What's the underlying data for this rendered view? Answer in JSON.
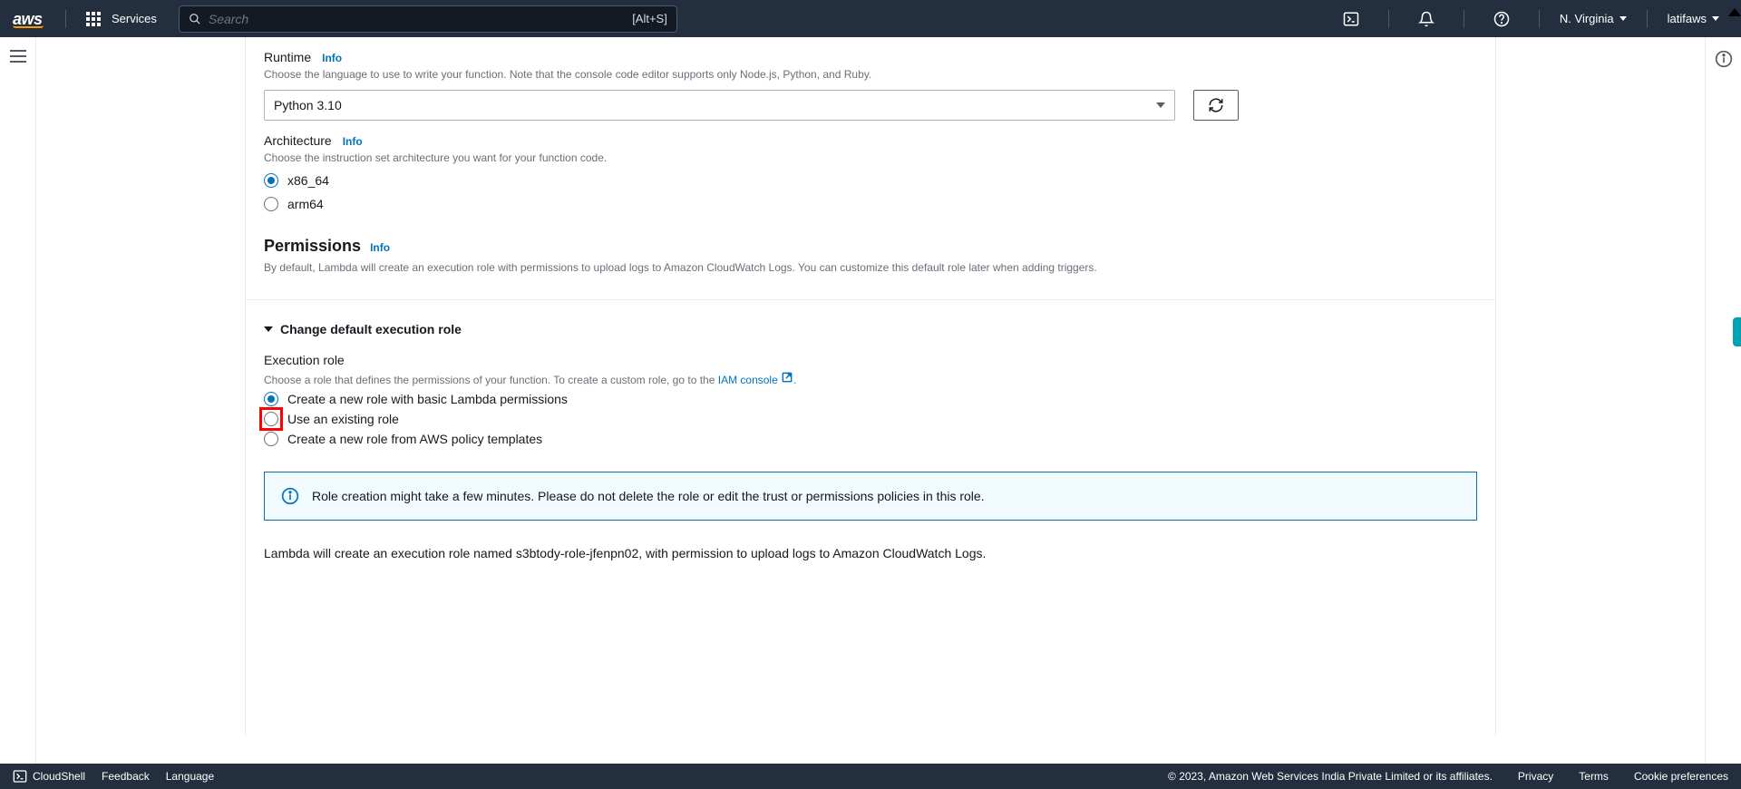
{
  "topnav": {
    "logo": "aws",
    "services": "Services",
    "search_placeholder": "Search",
    "search_kbd": "[Alt+S]",
    "region": "N. Virginia",
    "user": "latifaws"
  },
  "runtime": {
    "label": "Runtime",
    "info": "Info",
    "desc": "Choose the language to use to write your function. Note that the console code editor supports only Node.js, Python, and Ruby.",
    "selected": "Python 3.10"
  },
  "architecture": {
    "label": "Architecture",
    "info": "Info",
    "desc": "Choose the instruction set architecture you want for your function code.",
    "options": [
      "x86_64",
      "arm64"
    ],
    "selected": "x86_64"
  },
  "permissions": {
    "heading": "Permissions",
    "info": "Info",
    "desc": "By default, Lambda will create an execution role with permissions to upload logs to Amazon CloudWatch Logs. You can customize this default role later when adding triggers."
  },
  "exec_role": {
    "expander": "Change default execution role",
    "label": "Execution role",
    "desc_pre": "Choose a role that defines the permissions of your function. To create a custom role, go to the ",
    "iam_link": "IAM console",
    "desc_post": ".",
    "options": [
      "Create a new role with basic Lambda permissions",
      "Use an existing role",
      "Create a new role from AWS policy templates"
    ],
    "selected": "Create a new role with basic Lambda permissions"
  },
  "alert": "Role creation might take a few minutes. Please do not delete the role or edit the trust or permissions policies in this role.",
  "note": "Lambda will create an execution role named s3btody-role-jfenpn02, with permission to upload logs to Amazon CloudWatch Logs.",
  "footer": {
    "cloudshell": "CloudShell",
    "feedback": "Feedback",
    "language": "Language",
    "copyright": "© 2023, Amazon Web Services India Private Limited or its affiliates.",
    "privacy": "Privacy",
    "terms": "Terms",
    "cookies": "Cookie preferences"
  }
}
